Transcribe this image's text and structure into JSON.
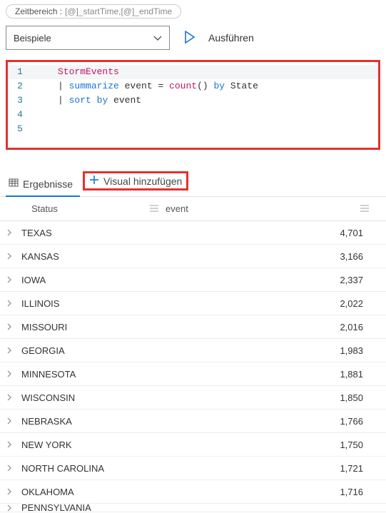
{
  "timerange": {
    "label": "Zeitbereich :",
    "value": "[@]_startTime,[@]_endTime"
  },
  "toolbar": {
    "dropdown": "Beispiele",
    "run": "Ausführen"
  },
  "editor": {
    "lines": [
      "1",
      "2",
      "3",
      "4",
      "5"
    ],
    "l1": {
      "a": "StormEvents"
    },
    "l2": {
      "pipe": "| ",
      "kw1": "summarize",
      "id1": " event ",
      "op": "= ",
      "call": "count",
      "paren": "() ",
      "kw2": "by",
      "id2": " State"
    },
    "l3": {
      "pipe": "| ",
      "kw1": "sort",
      "sp": " ",
      "kw2": "by",
      "id1": " event"
    }
  },
  "tabs": {
    "results": "Ergebnisse",
    "addvisual": "Visual hinzufügen"
  },
  "grid": {
    "headers": {
      "status": "Status",
      "event": "event"
    },
    "rows": [
      {
        "status": "TEXAS",
        "event": "4,701"
      },
      {
        "status": "KANSAS",
        "event": "3,166"
      },
      {
        "status": "IOWA",
        "event": "2,337"
      },
      {
        "status": "ILLINOIS",
        "event": "2,022"
      },
      {
        "status": "MISSOURI",
        "event": "2,016"
      },
      {
        "status": "GEORGIA",
        "event": "1,983"
      },
      {
        "status": "MINNESOTA",
        "event": "1,881"
      },
      {
        "status": "WISCONSIN",
        "event": "1,850"
      },
      {
        "status": "NEBRASKA",
        "event": "1,766"
      },
      {
        "status": "NEW YORK",
        "event": "1,750"
      },
      {
        "status": "NORTH CAROLINA",
        "event": "1,721"
      },
      {
        "status": "OKLAHOMA",
        "event": "1,716"
      },
      {
        "status": "PENNSYLVANIA",
        "event": ""
      }
    ]
  }
}
